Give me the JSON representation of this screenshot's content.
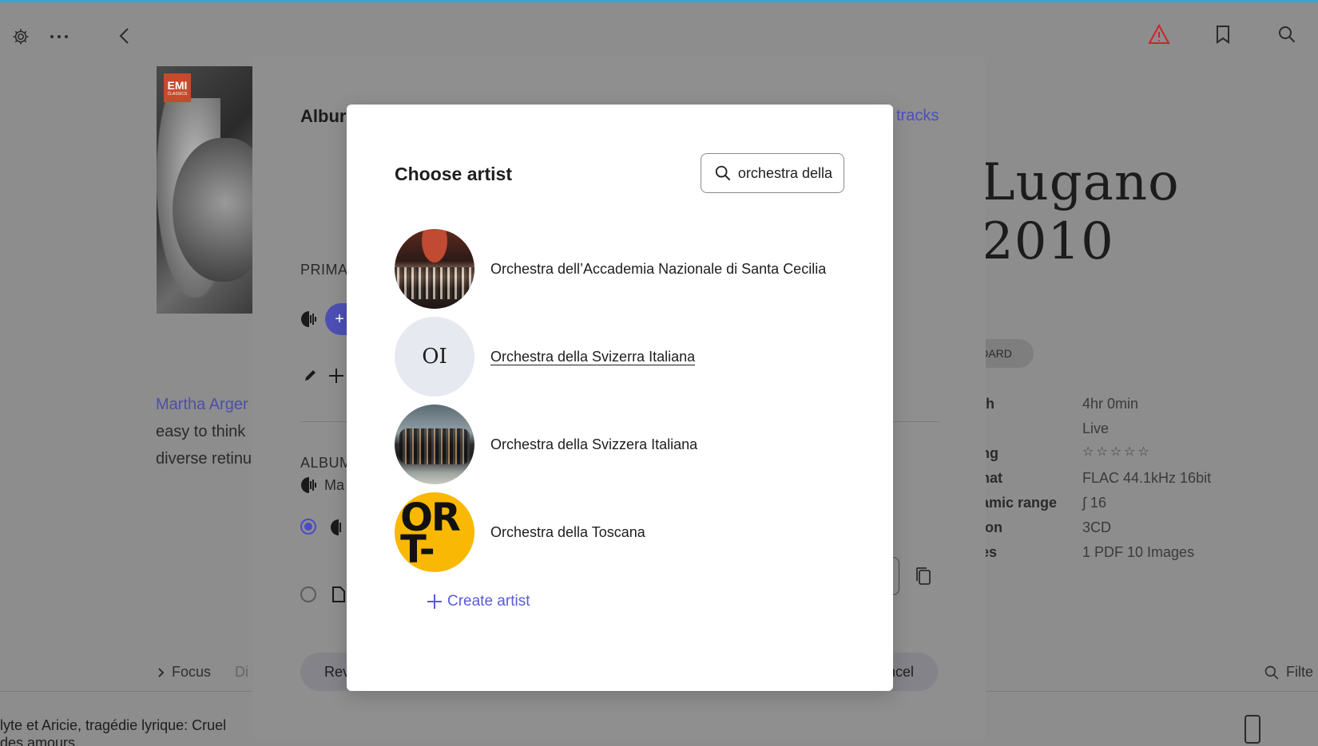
{
  "background": {
    "title": "Lugano 2010",
    "chip": "DARD",
    "description_link": "Martha Arger",
    "description_lines": [
      "easy to think",
      "diverse retinu"
    ],
    "meta": [
      {
        "key": "th",
        "value": "4hr 0min"
      },
      {
        "key": "",
        "value": "Live"
      },
      {
        "key": "ng",
        "value": "☆☆☆☆☆"
      },
      {
        "key": "nat",
        "value": "FLAC 44.1kHz 16bit"
      },
      {
        "key": "amic range",
        "value": "∫ 16"
      },
      {
        "key": "ion",
        "value": "3CD"
      },
      {
        "key": "es",
        "value": "1 PDF  10 Images"
      }
    ],
    "focus_label": "Focus",
    "focus_extra": "Di",
    "filter_label": "Filte",
    "now_playing_line1": "lyte et Aricie, tragédie lyrique: Cruel",
    "now_playing_line2": "des amours",
    "cover_label": "EMI",
    "cover_sub": "CLASSICS"
  },
  "outer_modal": {
    "title": "Albur",
    "tracks_link": "tracks",
    "primary_label": "PRIMA",
    "album_label": "ALBUM",
    "album_artist": "Ma",
    "review_button": "Rev",
    "cancel_button": "ncel"
  },
  "dialog": {
    "title": "Choose artist",
    "search_value": "orchestra della",
    "artists": [
      {
        "name": "Orchestra dell’Accademia Nazionale di Santa Cecilia",
        "initials": ""
      },
      {
        "name": "Orchestra della Svizerra Italiana",
        "initials": "OI"
      },
      {
        "name": "Orchestra della Svizzera Italiana",
        "initials": ""
      },
      {
        "name": "Orchestra della Toscana",
        "initials": "OR\nT-"
      }
    ],
    "create_label": "Create artist"
  },
  "colors": {
    "accent": "#5a5ad6",
    "warning": "#c7262b",
    "overlay": "#8d8d8d"
  }
}
